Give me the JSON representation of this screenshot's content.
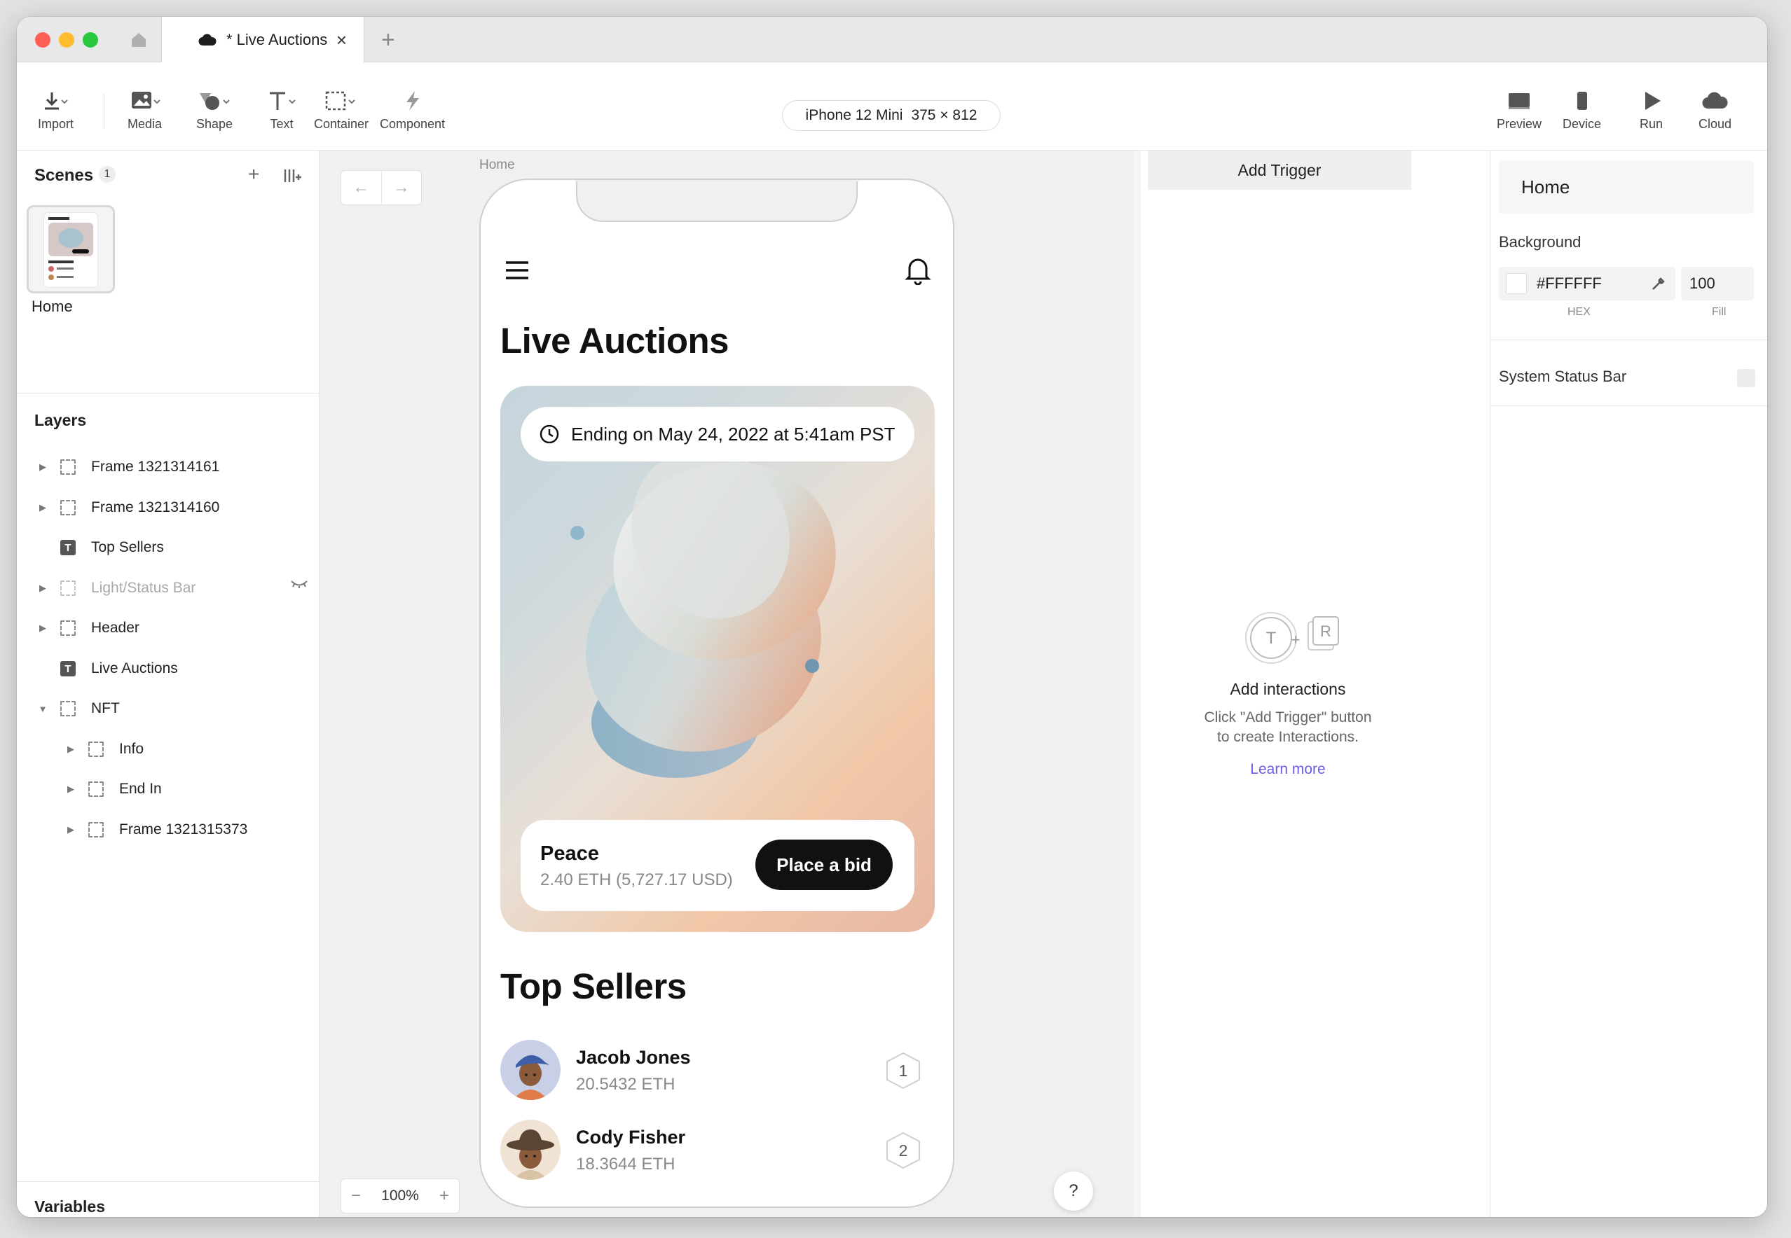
{
  "tabs": {
    "active_title": "* Live Auctions",
    "close": "×",
    "add": "+"
  },
  "toolbar": {
    "import": "Import",
    "media": "Media",
    "shape": "Shape",
    "text": "Text",
    "container": "Container",
    "component": "Component",
    "device_name": "iPhone 12 Mini",
    "device_size": "375 × 812",
    "preview": "Preview",
    "device": "Device",
    "run": "Run",
    "cloud": "Cloud"
  },
  "scenes": {
    "title": "Scenes",
    "count": "1",
    "add": "+",
    "items": [
      {
        "label": "Home"
      }
    ]
  },
  "layers": {
    "title": "Layers",
    "items": [
      {
        "label": "Frame 1321314161"
      },
      {
        "label": "Frame 1321314160"
      },
      {
        "label": "Top Sellers"
      },
      {
        "label": "Light/Status Bar"
      },
      {
        "label": "Header"
      },
      {
        "label": "Live Auctions"
      },
      {
        "label": "NFT"
      },
      {
        "label": "Info"
      },
      {
        "label": "End In"
      },
      {
        "label": "Frame 1321315373"
      }
    ]
  },
  "variables": {
    "title": "Variables"
  },
  "canvas": {
    "scene_label": "Home",
    "zoom": "100%",
    "zoom_minus": "−",
    "zoom_plus": "+",
    "help": "?",
    "back": "←",
    "forward": "→"
  },
  "phone": {
    "title": "Live Auctions",
    "ending": "Ending on May 24, 2022 at 5:41am PST",
    "nft_name": "Peace",
    "nft_price": "2.40 ETH (5,727.17 USD)",
    "bid_button": "Place a bid",
    "sellers_title": "Top Sellers",
    "sellers": [
      {
        "name": "Jacob Jones",
        "eth": "20.5432 ETH",
        "rank": "1"
      },
      {
        "name": "Cody Fisher",
        "eth": "18.3644 ETH",
        "rank": "2"
      }
    ]
  },
  "trigger": {
    "add_trigger": "Add Trigger",
    "t": "T",
    "plus": "+",
    "r": "R",
    "title": "Add interactions",
    "desc_line1": "Click \"Add Trigger\" button",
    "desc_line2": "to create Interactions.",
    "learn_more": "Learn more"
  },
  "props": {
    "scene_name": "Home",
    "background_label": "Background",
    "hex_value": "#FFFFFF",
    "fill_value": "100",
    "hex_caption": "HEX",
    "fill_caption": "Fill",
    "status_bar_label": "System Status Bar"
  },
  "colors": {
    "accent": "#6b5ce7",
    "close": "#ff5f57",
    "minimize": "#febc2e",
    "zoom": "#28c840"
  }
}
